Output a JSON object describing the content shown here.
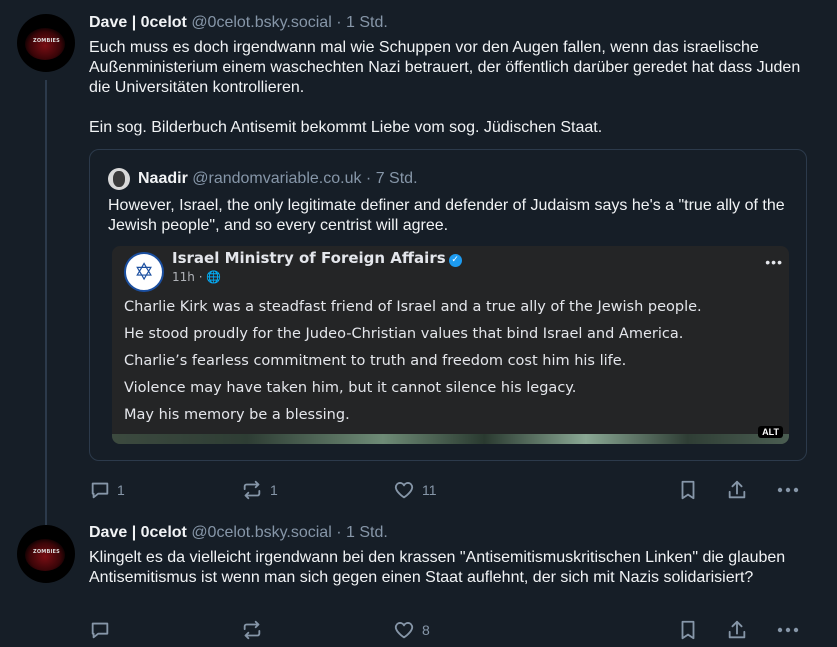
{
  "posts": [
    {
      "author": "Dave | 0celot",
      "handle": "@0celot.bsky.social",
      "separator": "·",
      "time": "1 Std.",
      "text": "Euch muss es doch irgendwann mal wie Schuppen vor den Augen fallen, wenn das israelische Außenministerium einem waschechten Nazi betrauert, der öffentlich darüber geredet hat dass Juden die Universitäten kontrollieren.\n\nEin sog. Bilderbuch Antisemit bekommt Liebe vom sog. Jüdischen Staat.",
      "avatar_tag": "ZOMBIES",
      "quote": {
        "author": "Naadir",
        "handle": "@randomvariable.co.uk",
        "separator": "·",
        "time": "7 Std.",
        "text": "However, Israel, the only legitimate definer and defender of Judaism says he's a \"true ally of the Jewish people\", and so every centrist will agree.",
        "embed": {
          "page_name": "Israel Ministry of Foreign Affairs",
          "verified_icon": "✓",
          "meta": "11h · 🌐",
          "more": "•••",
          "lines": [
            "Charlie Kirk was a steadfast friend of Israel and a true ally of the Jewish people.",
            "He stood proudly for the Judeo-Christian values that bind Israel and America.",
            "Charlie’s fearless commitment to truth and freedom cost him his life.",
            "Violence may have taken him, but it cannot silence his legacy.",
            "May his memory be a blessing."
          ],
          "alt_badge": "ALT",
          "logo_glyph": "✡"
        }
      },
      "actions": {
        "replies": "1",
        "reposts": "1",
        "likes": "11"
      }
    },
    {
      "author": "Dave | 0celot",
      "handle": "@0celot.bsky.social",
      "separator": "·",
      "time": "1 Std.",
      "text": "Klingelt es da vielleicht irgendwann bei den krassen \"Antisemitismuskritischen Linken\" die glauben Antisemitismus ist wenn man sich gegen einen Staat auflehnt, der sich mit Nazis solidarisiert?",
      "avatar_tag": "ZOMBIES",
      "actions": {
        "replies": "",
        "reposts": "",
        "likes": "8"
      }
    }
  ],
  "icons": {
    "reply": "reply-icon",
    "repost": "repost-icon",
    "like": "heart-icon",
    "bookmark": "bookmark-icon",
    "share": "share-icon",
    "more": "more-icon"
  },
  "colors": {
    "background": "#161e27",
    "muted": "#8696a8",
    "border": "#2c3a4b",
    "verified": "#1d9bf0"
  }
}
